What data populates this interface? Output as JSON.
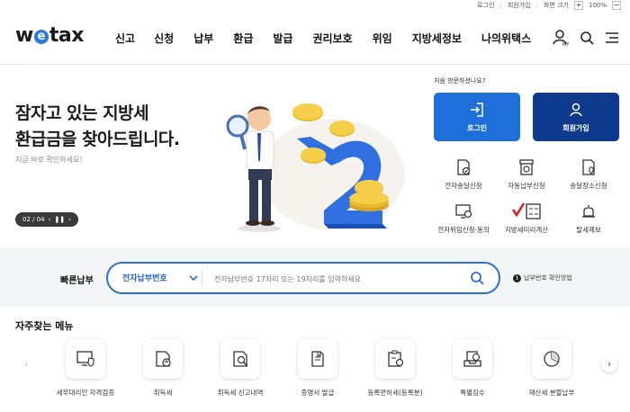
{
  "util": {
    "login": "로그인",
    "join": "회원가입",
    "font_size": "화면 크기",
    "plus": "+",
    "zoom": "100%",
    "minus": "−"
  },
  "header": {
    "logo_pre": "w",
    "logo_e": "e",
    "logo_post": "tax",
    "nav": [
      "신고",
      "신청",
      "납부",
      "환급",
      "발급",
      "권리보호",
      "위임",
      "지방세정보",
      "나의위택스"
    ],
    "my_label": "MY"
  },
  "hero": {
    "title_line1": "잠자고 있는 지방세",
    "title_line2": "환급금을 찾아드립니다.",
    "subtitle": "지금 바로 확인하세요!",
    "pager": "02 / 04",
    "first_visit": "처음 방문하셨나요?",
    "login_btn": "로그인",
    "join_btn": "회원가입"
  },
  "quick": [
    {
      "label": "전자송달신청",
      "icon": "document-check-icon"
    },
    {
      "label": "자동납부신청",
      "icon": "auto-pay-icon"
    },
    {
      "label": "송달장소신청",
      "icon": "location-doc-icon"
    },
    {
      "label": "전자위임신청·동의",
      "icon": "monitor-check-icon"
    },
    {
      "label": "지방세미리계산",
      "icon": "calculator-icon"
    },
    {
      "label": "탈세제보",
      "icon": "bell-icon"
    }
  ],
  "pay": {
    "label": "빠른납부",
    "select": "전자납부번호",
    "placeholder": "전자납부번호 17자리 또는 19자리를 입력하세요",
    "help": "납부번호 확인방법",
    "help_icon": "!"
  },
  "favorites": {
    "title": "자주찾는 메뉴",
    "items": [
      {
        "label": "세무대리인 자격검증",
        "icon": "monitor-shield-icon"
      },
      {
        "label": "취득세",
        "icon": "house-doc-icon"
      },
      {
        "label": "취득세 신고내역",
        "icon": "search-doc-icon"
      },
      {
        "label": "증명서 발급",
        "icon": "certificate-icon"
      },
      {
        "label": "등록면허세(등록분)",
        "icon": "clipboard-icon"
      },
      {
        "label": "특별징수",
        "icon": "tray-check-icon"
      },
      {
        "label": "재산세 분할납부",
        "icon": "pie-icon"
      }
    ]
  },
  "colors": {
    "primary": "#1e6fd9",
    "navy": "#0d3a8c",
    "accent_red": "#e02020"
  }
}
